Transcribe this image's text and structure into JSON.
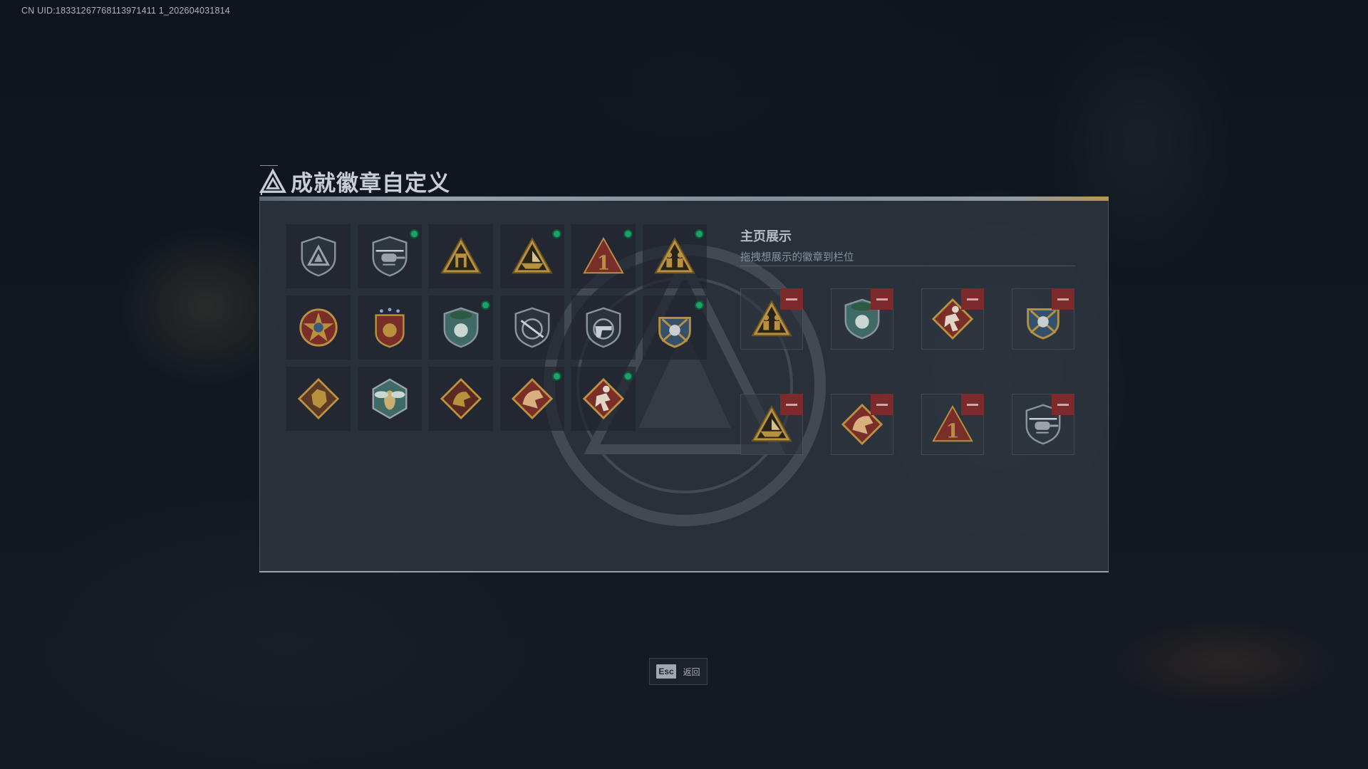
{
  "uid_text": "CN UID:18331267768113971411 1_202604031814",
  "title": "成就徽章自定义",
  "showcase": {
    "title": "主页展示",
    "subtitle": "拖拽想展示的徽章到栏位"
  },
  "badges": [
    {
      "name": "triangle-shield-badge-icon",
      "new": false
    },
    {
      "name": "helicopter-badge-icon",
      "new": true
    },
    {
      "name": "gate-pyramid-badge-icon",
      "new": false
    },
    {
      "name": "boat-pyramid-badge-icon",
      "new": true
    },
    {
      "name": "number-one-pyramid-badge-icon",
      "new": true
    },
    {
      "name": "soldiers-pyramid-badge-icon",
      "new": true
    },
    {
      "name": "star-wreath-badge-icon",
      "new": false
    },
    {
      "name": "stars-crest-badge-icon",
      "new": false
    },
    {
      "name": "beret-shield-badge-icon",
      "new": true
    },
    {
      "name": "rifle-shield-badge-icon",
      "new": false
    },
    {
      "name": "pistol-shield-badge-icon",
      "new": false
    },
    {
      "name": "crossed-rifles-badge-icon",
      "new": true
    },
    {
      "name": "wolf-diamond-badge-icon",
      "new": false
    },
    {
      "name": "hornet-hexagon-badge-icon",
      "new": false
    },
    {
      "name": "dragon-diamond-badge-icon",
      "new": false
    },
    {
      "name": "red-dragon-diamond-badge-icon",
      "new": true
    },
    {
      "name": "runner-diamond-badge-icon",
      "new": true
    }
  ],
  "slots": [
    {
      "name": "soldiers-pyramid-badge-icon"
    },
    {
      "name": "beret-shield-badge-icon"
    },
    {
      "name": "runner-diamond-badge-icon"
    },
    {
      "name": "crossed-rifles-badge-icon"
    },
    {
      "name": "boat-pyramid-badge-icon"
    },
    {
      "name": "red-dragon-diamond-badge-icon"
    },
    {
      "name": "number-one-pyramid-badge-icon"
    },
    {
      "name": "helicopter-badge-icon"
    }
  ],
  "footer": {
    "esc_key": "Esc",
    "esc_label": "返回"
  },
  "colors": {
    "new_dot": "#1aa268",
    "remove_button": "#7c2a2c",
    "gold": "#b8913e",
    "crimson": "#7a2e2a",
    "teal": "#3f6a66",
    "slate": "#4a5560"
  }
}
